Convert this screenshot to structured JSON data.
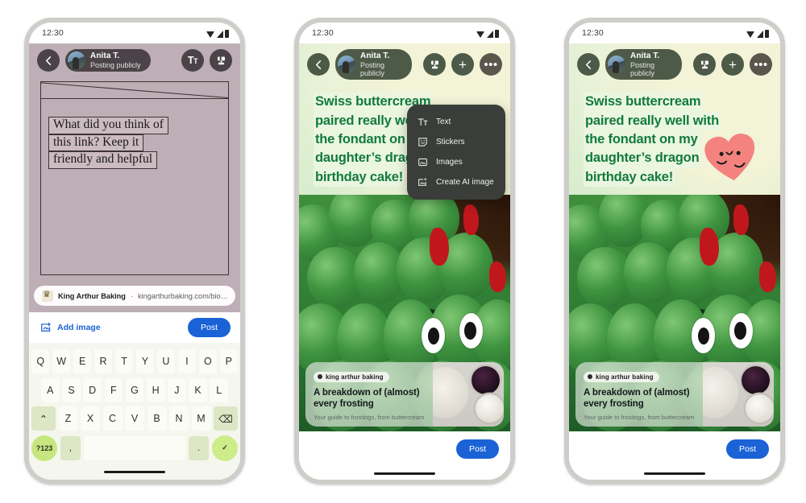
{
  "meta": {
    "accent_blue": "#1a62d6",
    "green_text": "#137a3c",
    "phone1_bg": "#bdafb5",
    "phone23_bg": "#d3ebd0",
    "menu_bg": "#3a3d39",
    "heart_pink": "#f4837f"
  },
  "status_bar": {
    "time": "12:30",
    "icons": [
      "wifi-icon",
      "signal-icon",
      "battery-icon"
    ]
  },
  "header": {
    "back_icon": "back-arrow-icon",
    "user_name": "Anita T.",
    "user_subtitle": "Posting publicly",
    "avatar": "avatar",
    "actions_phone1": [
      {
        "name": "text-format-button",
        "icon": "text-format-icon",
        "label": "Tt"
      },
      {
        "name": "stamp-tool-button",
        "icon": "stamp-icon",
        "label": ""
      }
    ],
    "actions_phone23": [
      {
        "name": "stamp-tool-button",
        "icon": "stamp-icon",
        "label": ""
      },
      {
        "name": "add-button",
        "icon": "plus-icon",
        "label": "+"
      },
      {
        "name": "more-options-button",
        "icon": "more-dots-icon",
        "label": "•••"
      }
    ]
  },
  "phone1": {
    "compose_lines": [
      "What did you think of",
      "this link? Keep it",
      "friendly and helpful"
    ],
    "link_chip": {
      "favicon": "king-arthur-crown-icon",
      "site_name": "King Arthur Baking",
      "separator": "·",
      "url": "kingarthurbaking.com/bio…"
    },
    "compose_bar": {
      "add_image_icon": "add-image-icon",
      "add_image_label": "Add image",
      "post_label": "Post"
    },
    "keyboard": {
      "row1": [
        "Q",
        "W",
        "E",
        "R",
        "T",
        "Y",
        "U",
        "I",
        "O",
        "P"
      ],
      "row2": [
        "A",
        "S",
        "D",
        "F",
        "G",
        "H",
        "J",
        "K",
        "L"
      ],
      "row3_shift": "⌃",
      "row3": [
        "Z",
        "X",
        "C",
        "V",
        "B",
        "N",
        "M"
      ],
      "row3_backspace": "⌫",
      "row4_symbols": "?123",
      "row4_comma": ",",
      "row4_space": "",
      "row4_period": ".",
      "row4_enter": "✓"
    }
  },
  "phone2": {
    "poem_lines": [
      "Swiss buttercream",
      "paired really well with",
      "the fondant on my",
      "daughter’s dragon",
      "birthday cake!"
    ],
    "menu": {
      "items": [
        {
          "icon": "text-format-icon",
          "label": "Text"
        },
        {
          "icon": "sticker-smiley-icon",
          "label": "Stickers"
        },
        {
          "icon": "image-icon",
          "label": "Images"
        },
        {
          "icon": "ai-image-icon",
          "label": "Create AI image"
        }
      ]
    },
    "preview": {
      "badge_label": "king arthur baking",
      "badge_icon": "site-dot-icon",
      "title": "A breakdown of (almost) every frosting",
      "description": "Your guide to frostings, from buttercream to c…",
      "thumb": "frosting-bowls-photo"
    },
    "post_label": "Post",
    "photo": "dragon-cake-photo"
  },
  "phone3": {
    "poem_lines": [
      "Swiss buttercream",
      "paired really well with",
      "the fondant on my",
      "daughter’s dragon",
      "birthday cake!"
    ],
    "sticker": "heart-smiley-sticker",
    "preview": {
      "badge_label": "king arthur baking",
      "badge_icon": "site-dot-icon",
      "title": "A breakdown of (almost) every frosting",
      "description": "Your guide to frostings, from buttercream to c…",
      "thumb": "frosting-bowls-photo"
    },
    "post_label": "Post",
    "photo": "dragon-cake-photo"
  }
}
